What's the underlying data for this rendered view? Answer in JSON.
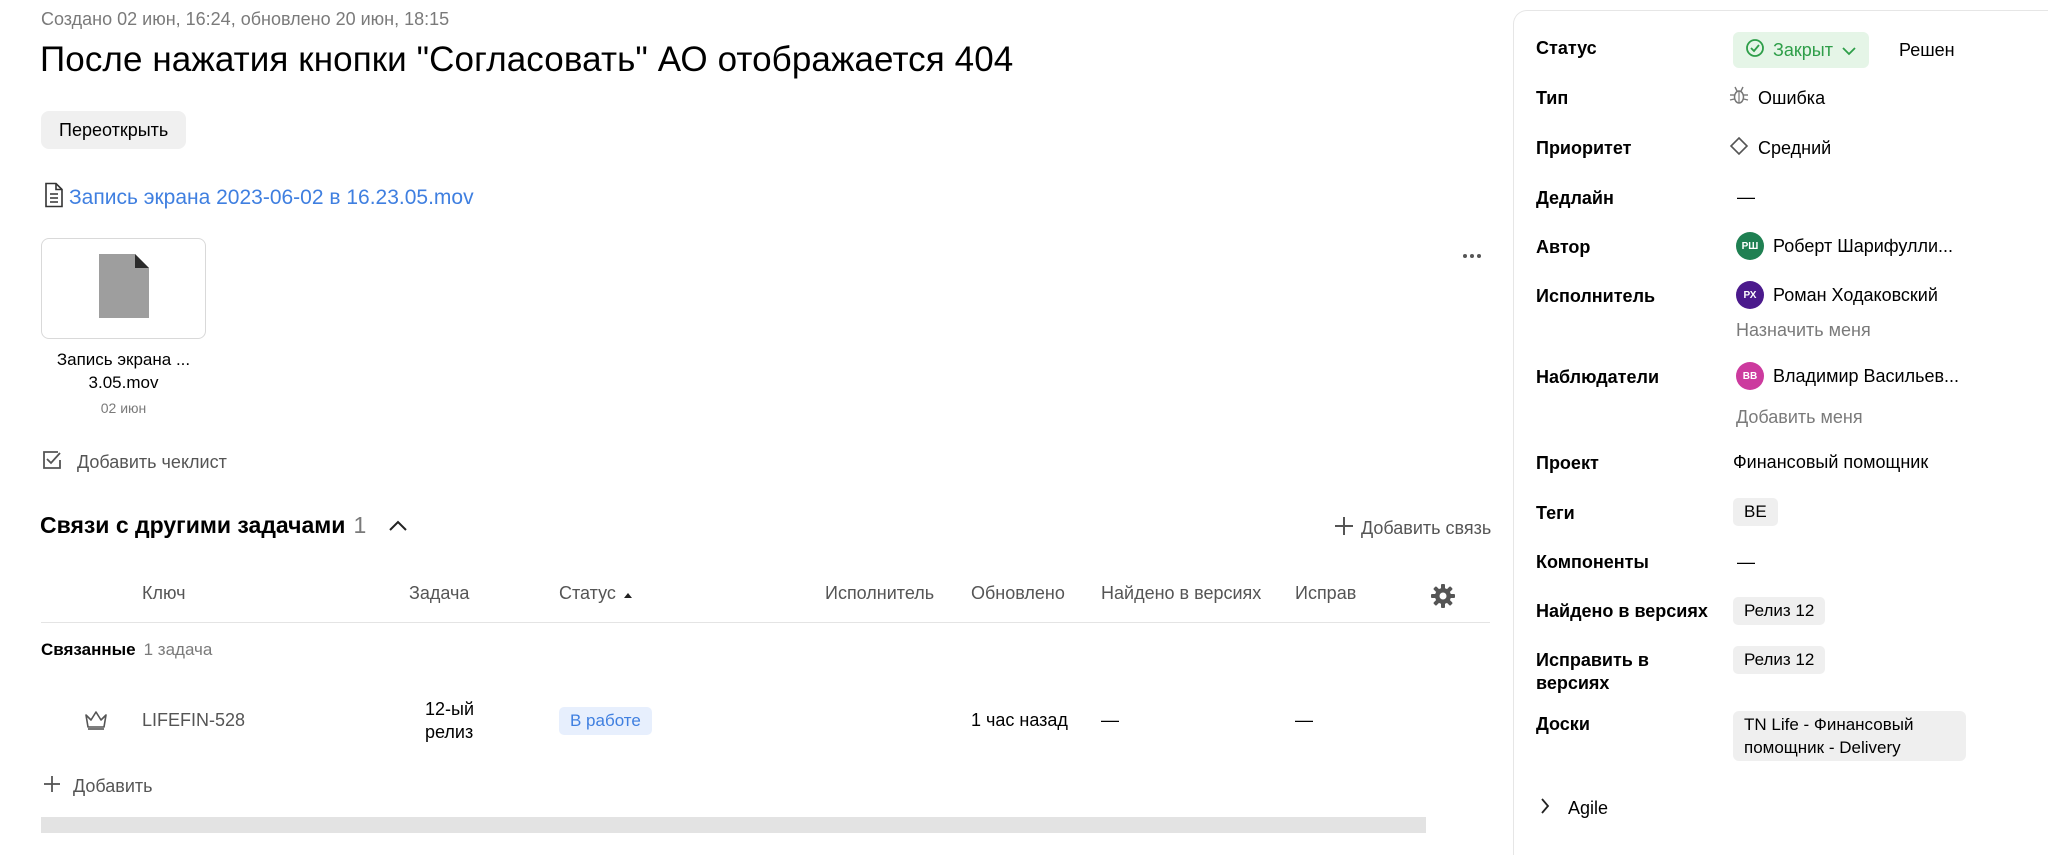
{
  "issue": {
    "meta": "Создано 02 июн, 16:24, обновлено 20 июн, 18:15",
    "title": "После нажатия кнопки \"Согласовать\" АО отображается 404",
    "reopen_label": "Переоткрыть",
    "attachment_link": "Запись экрана 2023-06-02 в 16.23.05.mov",
    "attachment": {
      "name": "Запись экрана ... 3.05.mov",
      "date": "02 июн"
    },
    "add_checklist": "Добавить чеклист"
  },
  "links": {
    "title": "Связи с другими задачами",
    "count": "1",
    "add_link": "Добавить связь",
    "columns": {
      "key": "Ключ",
      "task": "Задача",
      "status": "Статус",
      "assignee": "Исполнитель",
      "updated": "Обновлено",
      "found_in": "Найдено в версиях",
      "fix_in": "Исправить в версиях"
    },
    "group": {
      "label": "Связанные",
      "count": "1 задача"
    },
    "rows": [
      {
        "key": "LIFEFIN-528",
        "task": "12-ый релиз",
        "status": "В работе",
        "assignee": "",
        "updated": "1 час назад",
        "found_in": "—",
        "fix_in": "—"
      }
    ],
    "add_label": "Добавить"
  },
  "sidebar": {
    "status": {
      "label": "Статус",
      "value": "Закрыт",
      "resolution": "Решен",
      "color": "#2e9e49"
    },
    "type": {
      "label": "Тип",
      "value": "Ошибка",
      "icon": "bug-icon"
    },
    "priority": {
      "label": "Приоритет",
      "value": "Средний",
      "icon": "diamond-icon"
    },
    "deadline": {
      "label": "Дедлайн",
      "value": "—"
    },
    "author": {
      "label": "Автор",
      "initials": "РШ",
      "name": "Роберт Шарифулли...",
      "color": "#1f8052"
    },
    "assignee": {
      "label": "Исполнитель",
      "initials": "РХ",
      "name": "Роман Ходаковский",
      "color": "#4b1a8c",
      "assign_me": "Назначить меня"
    },
    "followers": {
      "label": "Наблюдатели",
      "initials": "ВВ",
      "name": "Владимир Васильев...",
      "color": "#cc3a9e",
      "add_me": "Добавить меня"
    },
    "project": {
      "label": "Проект",
      "value": "Финансовый помощник"
    },
    "tags": {
      "label": "Теги",
      "value": "BE"
    },
    "components": {
      "label": "Компоненты",
      "value": "—"
    },
    "found_in": {
      "label": "Найдено в версиях",
      "value": "Релиз 12"
    },
    "fix_in": {
      "label": "Исправить в версиях",
      "value": "Релиз 12"
    },
    "boards": {
      "label": "Доски",
      "value": "TN Life - Финансовый помощник - Delivery"
    },
    "agile": {
      "label": "Agile"
    }
  }
}
